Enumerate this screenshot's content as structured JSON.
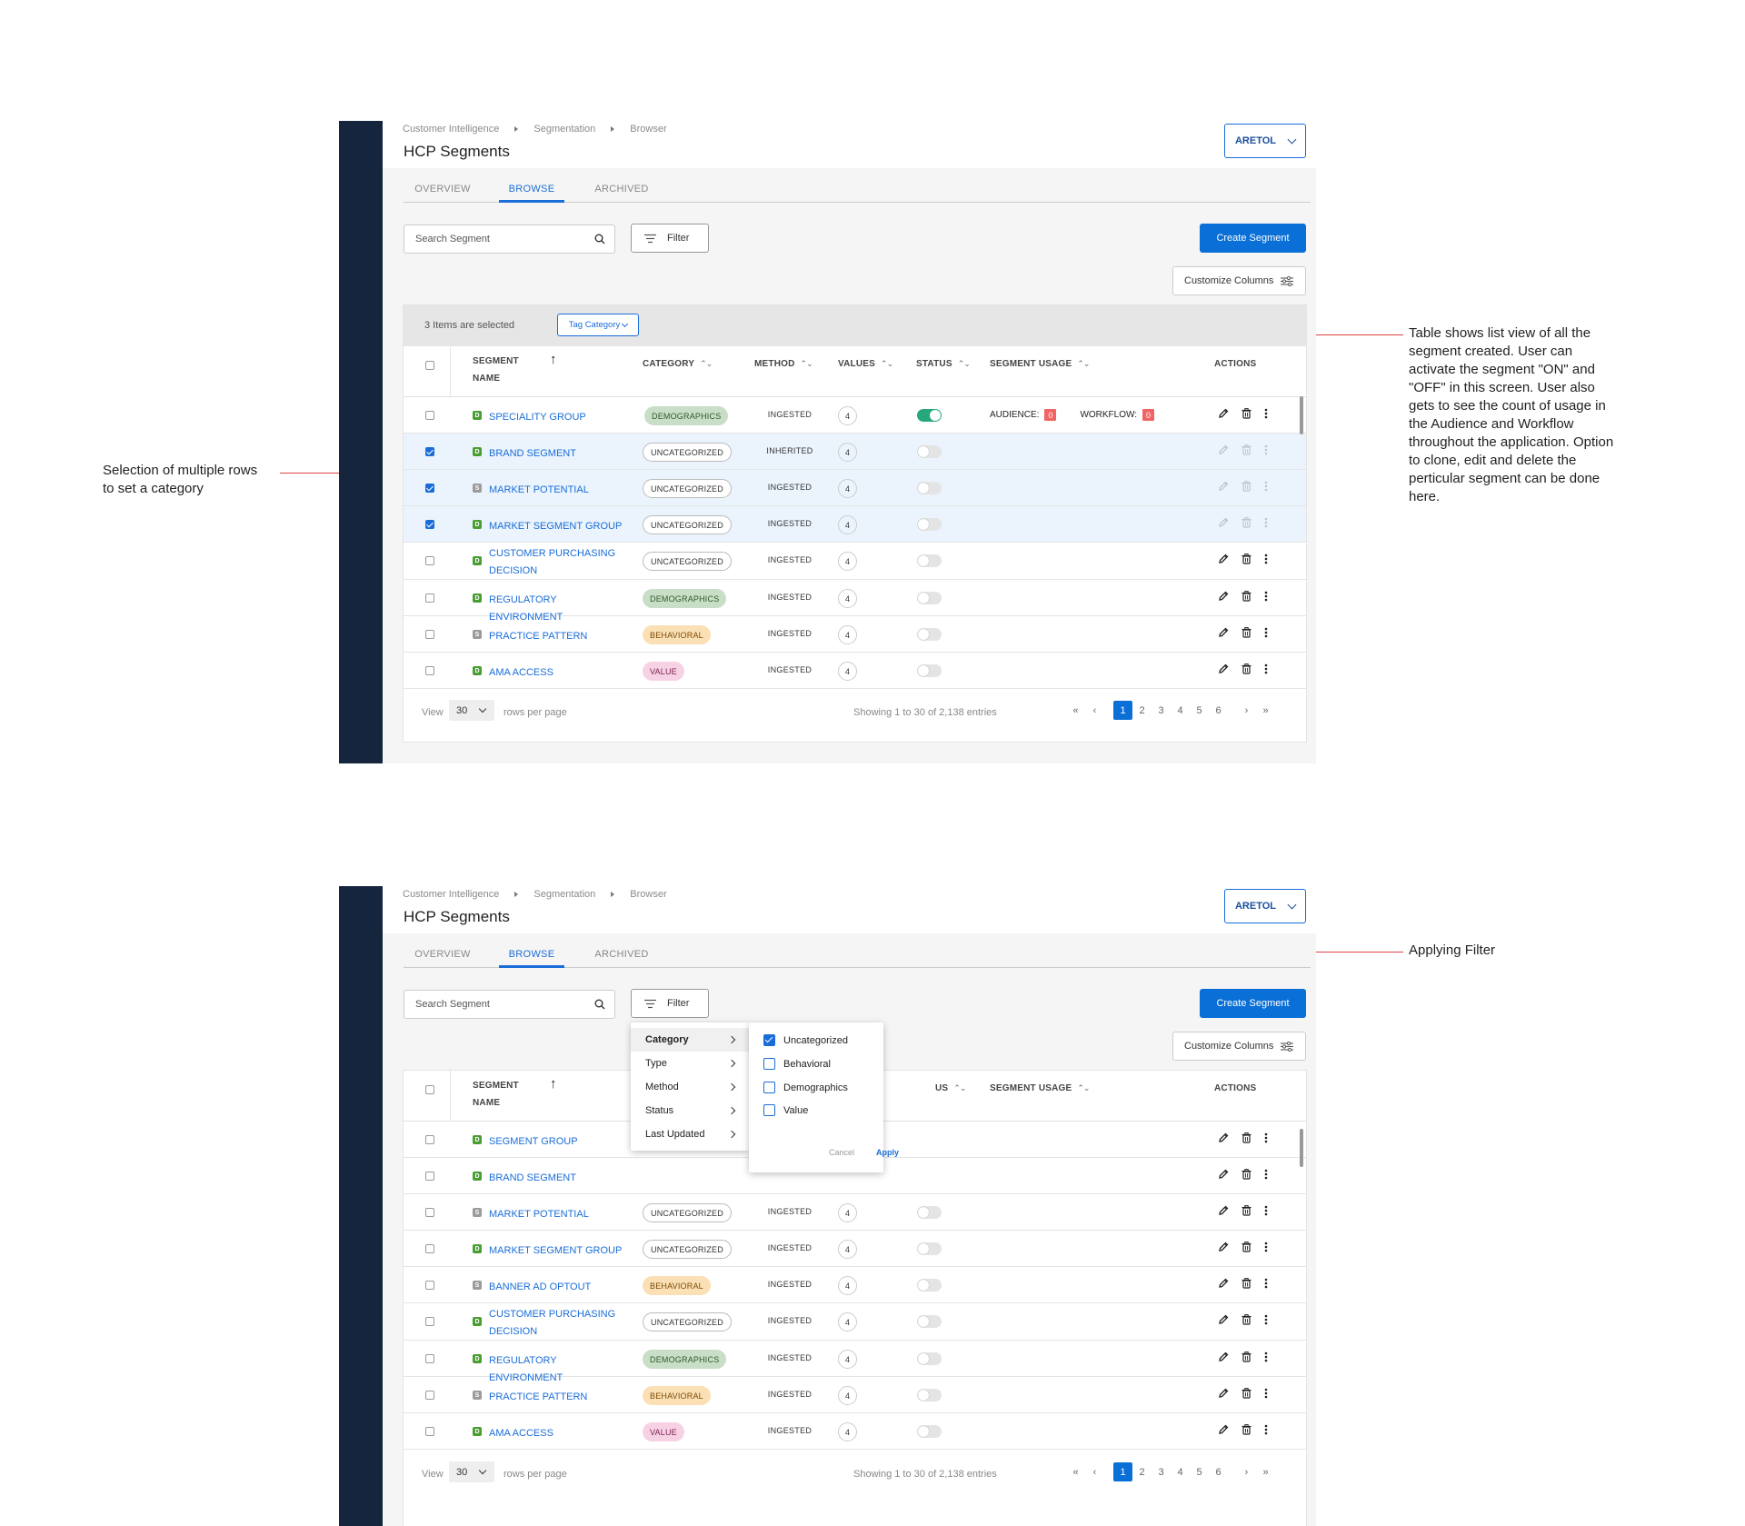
{
  "annotations": {
    "selection_note_line1": "Selection of multiple rows",
    "selection_note_line2": "to set a category",
    "table_note": "Table shows list view of all the segment created. User can activate the segment \"ON\" and \"OFF\" in this screen. User also gets to see the count of usage in the Audience and Workflow throughout the application. Option to clone, edit and delete the perticular segment can be done here.",
    "filter_note": "Applying Filter"
  },
  "header": {
    "breadcrumb": [
      "Customer Intelligence",
      "Segmentation",
      "Browser"
    ],
    "title": "HCP Segments",
    "user_label": "ARETOL"
  },
  "tabs": [
    {
      "label": "OVERVIEW",
      "active": false
    },
    {
      "label": "BROWSE",
      "active": true
    },
    {
      "label": "ARCHIVED",
      "active": false
    }
  ],
  "toolbar": {
    "search_placeholder": "Search Segment",
    "filter_label": "Filter",
    "create_label": "Create Segment",
    "customize_label": "Customize Columns"
  },
  "selection_bar": {
    "text": "3 Items are selected",
    "tag_category_label": "Tag Category"
  },
  "columns": {
    "segment_name_line1": "SEGMENT",
    "segment_name_line2": "NAME",
    "category": "CATEGORY",
    "method": "METHOD",
    "values": "VALUES",
    "status": "STATUS",
    "status_partial": "US",
    "segment_usage": "SEGMENT USAGE",
    "actions": "ACTIONS"
  },
  "usage_labels": {
    "audience": "AUDIENCE:",
    "workflow": "WORKFLOW:"
  },
  "table_a": [
    {
      "name": "SPECIALITY GROUP",
      "type": "D",
      "category": "DEMOGRAPHICS",
      "cat_class": "demographics",
      "method": "INGESTED",
      "values": "4",
      "status_on": true,
      "checked": false,
      "audience": "0",
      "workflow": "0"
    },
    {
      "name": "BRAND SEGMENT",
      "type": "D",
      "category": "UNCATEGORIZED",
      "cat_class": "uncategorized",
      "method": "INHERITED",
      "values": "4",
      "status_on": false,
      "checked": true
    },
    {
      "name": "MARKET POTENTIAL",
      "type": "S",
      "category": "UNCATEGORIZED",
      "cat_class": "uncategorized",
      "method": "INGESTED",
      "values": "4",
      "status_on": false,
      "checked": true
    },
    {
      "name": "MARKET SEGMENT GROUP",
      "type": "D",
      "category": "UNCATEGORIZED",
      "cat_class": "uncategorized",
      "method": "INGESTED",
      "values": "4",
      "status_on": false,
      "checked": true
    },
    {
      "name": "CUSTOMER PURCHASING DECISION",
      "type": "D",
      "category": "UNCATEGORIZED",
      "cat_class": "uncategorized",
      "method": "INGESTED",
      "values": "4",
      "status_on": false,
      "checked": false
    },
    {
      "name": "REGULATORY ENVIRONMENT",
      "type": "D",
      "category": "DEMOGRAPHICS",
      "cat_class": "demographics",
      "method": "INGESTED",
      "values": "4",
      "status_on": false,
      "checked": false
    },
    {
      "name": "PRACTICE PATTERN",
      "type": "S",
      "category": "BEHAVIORAL",
      "cat_class": "behavioral",
      "method": "INGESTED",
      "values": "4",
      "status_on": false,
      "checked": false
    },
    {
      "name": "AMA ACCESS",
      "type": "D",
      "category": "VALUE",
      "cat_class": "value",
      "method": "INGESTED",
      "values": "4",
      "status_on": false,
      "checked": false
    }
  ],
  "table_b": [
    {
      "name": "SEGMENT GROUP",
      "type": "D",
      "category": "",
      "cat_class": "",
      "method": "",
      "values": "",
      "status_on": false,
      "hidden": true
    },
    {
      "name": "BRAND SEGMENT",
      "type": "D",
      "category": "",
      "cat_class": "",
      "method": "",
      "values": "",
      "status_on": false,
      "hidden": true
    },
    {
      "name": "MARKET POTENTIAL",
      "type": "S",
      "category": "UNCATEGORIZED",
      "cat_class": "uncategorized",
      "method": "INGESTED",
      "values": "4",
      "status_on": false
    },
    {
      "name": "MARKET SEGMENT GROUP",
      "type": "D",
      "category": "UNCATEGORIZED",
      "cat_class": "uncategorized",
      "method": "INGESTED",
      "values": "4",
      "status_on": false
    },
    {
      "name": "BANNER AD OPTOUT",
      "type": "S",
      "category": "BEHAVIORAL",
      "cat_class": "behavioral",
      "method": "INGESTED",
      "values": "4",
      "status_on": false
    },
    {
      "name": "CUSTOMER PURCHASING DECISION",
      "type": "D",
      "category": "UNCATEGORIZED",
      "cat_class": "uncategorized",
      "method": "INGESTED",
      "values": "4",
      "status_on": false
    },
    {
      "name": "REGULATORY ENVIRONMENT",
      "type": "D",
      "category": "DEMOGRAPHICS",
      "cat_class": "demographics",
      "method": "INGESTED",
      "values": "4",
      "status_on": false
    },
    {
      "name": "PRACTICE PATTERN",
      "type": "S",
      "category": "BEHAVIORAL",
      "cat_class": "behavioral",
      "method": "INGESTED",
      "values": "4",
      "status_on": false
    },
    {
      "name": "AMA ACCESS",
      "type": "D",
      "category": "VALUE",
      "cat_class": "value",
      "method": "INGESTED",
      "values": "4",
      "status_on": false
    }
  ],
  "pager": {
    "view_label": "View",
    "rows_value": "30",
    "per_page_label": "rows per page",
    "showing": "Showing 1 to 30 of 2,138 entries",
    "pages": [
      "1",
      "2",
      "3",
      "4",
      "5",
      "6"
    ],
    "active_page": "1"
  },
  "filter_menu": {
    "items": [
      "Category",
      "Type",
      "Method",
      "Status",
      "Last Updated"
    ],
    "active": "Category",
    "options": [
      {
        "label": "Uncategorized",
        "checked": true
      },
      {
        "label": "Behavioral",
        "checked": false
      },
      {
        "label": "Demographics",
        "checked": false
      },
      {
        "label": "Value",
        "checked": false
      }
    ],
    "cancel_label": "Cancel",
    "apply_label": "Apply"
  },
  "colors": {
    "navbar": "#14253d",
    "accent": "#0a6fd6",
    "toggle_on": "#26a87a",
    "usage_badge": "#f06464"
  }
}
